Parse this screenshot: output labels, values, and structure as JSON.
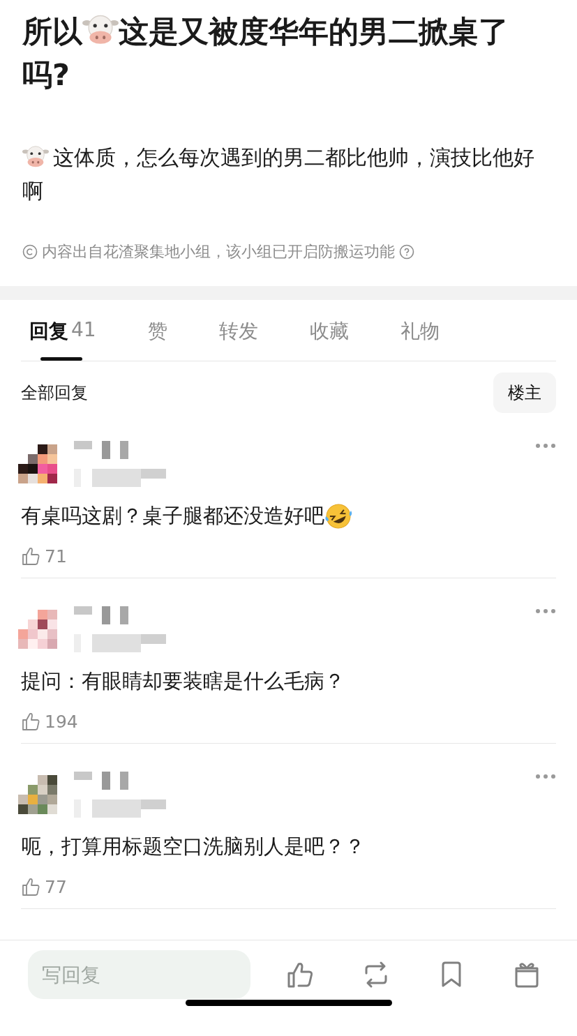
{
  "post": {
    "title": [
      {
        "kind": "text",
        "text": "所以"
      },
      {
        "kind": "cow"
      },
      {
        "kind": "text",
        "text": "这是又被度华年的男二掀桌了吗?"
      }
    ],
    "body": [
      {
        "kind": "cow"
      },
      {
        "kind": "text",
        "text": "这体质，怎么每次遇到的男二都比他帅，演技比他好啊"
      }
    ],
    "notice": "内容出自花渣聚集地小组，该小组已开启防搬运功能"
  },
  "tabs": [
    {
      "label": "回复",
      "count": "41",
      "selected": true
    },
    {
      "label": "赞",
      "selected": false
    },
    {
      "label": "转发",
      "selected": false
    },
    {
      "label": "收藏",
      "selected": false
    },
    {
      "label": "礼物",
      "selected": false
    }
  ],
  "filter": {
    "label": "全部回复",
    "button": "楼主"
  },
  "comments": [
    {
      "avatar": {
        "kind": "picture"
      },
      "author": {
        "kind": "pixelated"
      },
      "text": [
        {
          "kind": "text",
          "text": "有桌吗这剧？桌子腿都还没造好吧"
        },
        {
          "kind": "rofl"
        }
      ],
      "likes": "71"
    },
    {
      "avatar": {
        "kind": "picture"
      },
      "author": {
        "kind": "pixelated"
      },
      "text": [
        {
          "kind": "text",
          "text": "提问：有眼睛却要装瞎是什么毛病？"
        }
      ],
      "likes": "194"
    },
    {
      "avatar": {
        "kind": "picture"
      },
      "author": {
        "kind": "pixelated"
      },
      "text": [
        {
          "kind": "text",
          "text": "呃，打算用标题空口洗脑别人是吧？？"
        }
      ],
      "likes": "77"
    }
  ],
  "reply_bar": {
    "placeholder": "写回复"
  }
}
